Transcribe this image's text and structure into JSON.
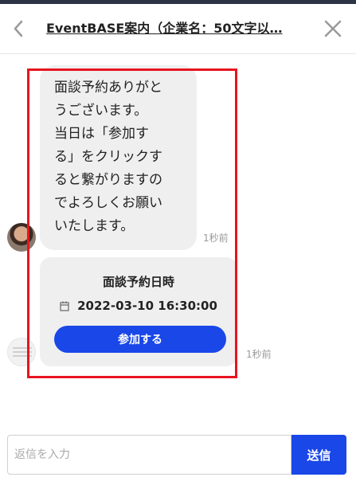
{
  "header": {
    "title": "EventBASE案内（企業名：50文字以…",
    "back_icon": "chevron-left-icon",
    "close_icon": "close-icon"
  },
  "messages": [
    {
      "text": "面談予約ありがと\nうございます。\n当日は「参加す\nる」をクリックす\nると繋がりますの\nでよろしくお願い\nいたします。",
      "time": "1秒前"
    },
    {
      "card_title": "面談予約日時",
      "date_icon": "calendar-icon",
      "datetime": "2022-03-10 16:30:00",
      "button_label": "参加する",
      "time": "1秒前"
    }
  ],
  "composer": {
    "placeholder": "返信を入力",
    "value": "",
    "send_label": "送信"
  },
  "colors": {
    "accent": "#1a47e8",
    "highlight": "#e8141e",
    "bubble": "#efefef"
  }
}
